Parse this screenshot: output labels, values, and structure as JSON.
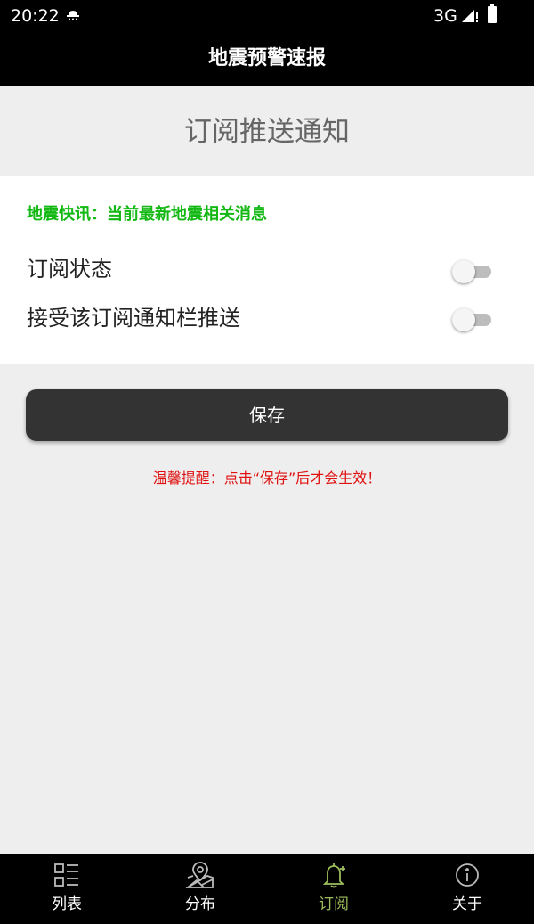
{
  "status_bar": {
    "time": "20:22",
    "network": "3G"
  },
  "app_bar": {
    "title": "地震预警速报"
  },
  "section": {
    "title": "订阅推送通知"
  },
  "card": {
    "flash_title": "地震快讯：当前最新地震相关消息",
    "settings": [
      {
        "label": "订阅状态",
        "enabled": false
      },
      {
        "label": "接受该订阅通知栏推送",
        "enabled": false
      }
    ]
  },
  "save_button": {
    "label": "保存"
  },
  "tip": {
    "text": "温馨提醒：点击“保存”后才会生效！"
  },
  "bottom_nav": {
    "items": [
      {
        "label": "列表",
        "icon": "list-icon",
        "active": false
      },
      {
        "label": "分布",
        "icon": "map-pin-icon",
        "active": false
      },
      {
        "label": "订阅",
        "icon": "bell-icon",
        "active": true
      },
      {
        "label": "关于",
        "icon": "info-icon",
        "active": false
      }
    ]
  },
  "colors": {
    "accent_green": "#13b813",
    "tip_red": "#e01010",
    "nav_active": "#9cbd5b",
    "button_dark": "#333333"
  }
}
